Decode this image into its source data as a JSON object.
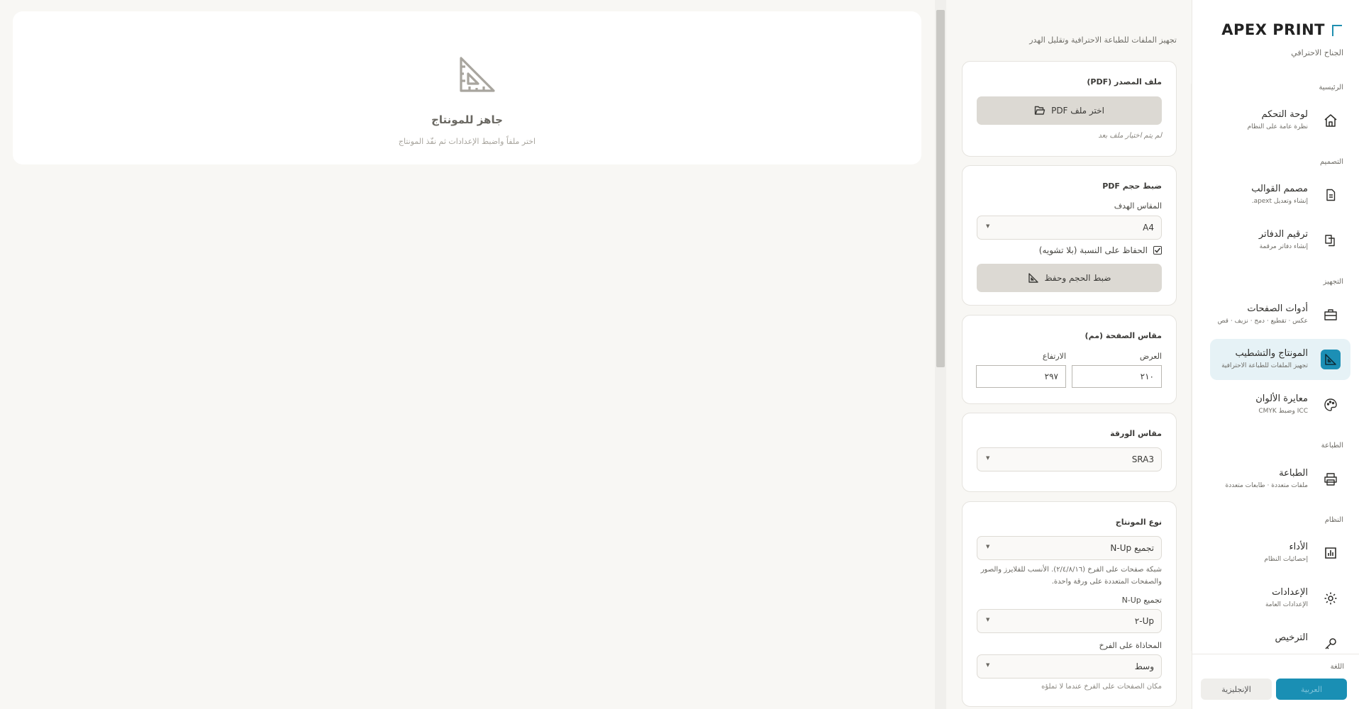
{
  "preview": {
    "title": "جاهز للمونتاج",
    "subtitle": "اختر ملفاً واضبط الإعدادات ثم نفّذ المونتاج",
    "icon": "set-square-icon"
  },
  "panel": {
    "description": "تجهيز الملفات للطباعة الاحترافية وتقليل الهدر",
    "source": {
      "title": "ملف المصدر (PDF)",
      "button_label": "اختر ملف PDF",
      "button_icon": "folder-icon",
      "no_file_note": "لم يتم اختيار ملف بعد"
    },
    "resize": {
      "title": "ضبط حجم PDF",
      "target_label": "المقاس الهدف",
      "target_value": "A4",
      "keep_ratio_label": "الحفاظ على النسبة (بلا تشويه)",
      "keep_ratio_checked": true,
      "button_label": "ضبط الحجم وحفظ",
      "button_icon": "set-square-icon"
    },
    "page_size": {
      "title": "مقاس الصفحة (مم)",
      "width_label": "العرض",
      "width_value": "٢١٠",
      "height_label": "الارتفاع",
      "height_value": "٢٩٧"
    },
    "paper": {
      "title": "مقاس الورقة",
      "value": "SRA3"
    },
    "imposition": {
      "title": "نوع المونتاج",
      "type_value": "تجميع N-Up",
      "help": "شبكة صفحات على الفرخ (٢/٤/٨/١٦). الأنسب للفلايرز والصور والصفحات المتعددة على ورقة واحدة.",
      "nup_label": "تجميع N-Up",
      "nup_value": "Up-٢",
      "align_label": "المحاذاة على الفرخ",
      "align_value": "وسط",
      "align_note": "مكان الصفحات على الفرخ عندما لا تملؤه"
    }
  },
  "sidebar": {
    "brand": "APEX PRINT",
    "subtitle": "الجناح الاحترافي",
    "sections": {
      "main": "الرئيسية",
      "design": "التصميم",
      "prep": "التجهيز",
      "print": "الطباعة",
      "system": "النظام"
    },
    "items": [
      {
        "title": "لوحة التحكم",
        "sub": "نظرة عامة على النظام",
        "icon": "home-icon"
      },
      {
        "title": "مصمم القوالب",
        "sub": "إنشاء وتعديل apext.",
        "icon": "document-icon"
      },
      {
        "title": "ترقيم الدفاتر",
        "sub": "إنشاء دفاتر مرقمة",
        "icon": "copy-icon"
      },
      {
        "title": "أدوات الصفحات",
        "sub": "عكس · تقطيع · دمج · نزيف · قص",
        "icon": "toolbox-icon"
      },
      {
        "title": "المونتاج والتشطيب",
        "sub": "تجهيز الملفات للطباعة الاحترافية",
        "icon": "set-square-icon"
      },
      {
        "title": "معايرة الألوان",
        "sub": "ICC وضبط CMYK",
        "icon": "palette-icon"
      },
      {
        "title": "الطباعة",
        "sub": "ملفات متعددة · طابعات متعددة",
        "icon": "printer-icon"
      },
      {
        "title": "الأداء",
        "sub": "إحصائيات النظام",
        "icon": "bar-chart-icon"
      },
      {
        "title": "الإعدادات",
        "sub": "الإعدادات العامة",
        "icon": "gear-icon"
      },
      {
        "title": "الترخيص",
        "sub": "",
        "icon": "key-icon"
      }
    ],
    "language": {
      "label": "اللغة",
      "arabic": "العربية",
      "english": "الإنجليزية"
    }
  },
  "colors": {
    "accent": "#1c8fb5",
    "active_bg": "#e6f2f6",
    "button_gray": "#dcd9d3"
  }
}
